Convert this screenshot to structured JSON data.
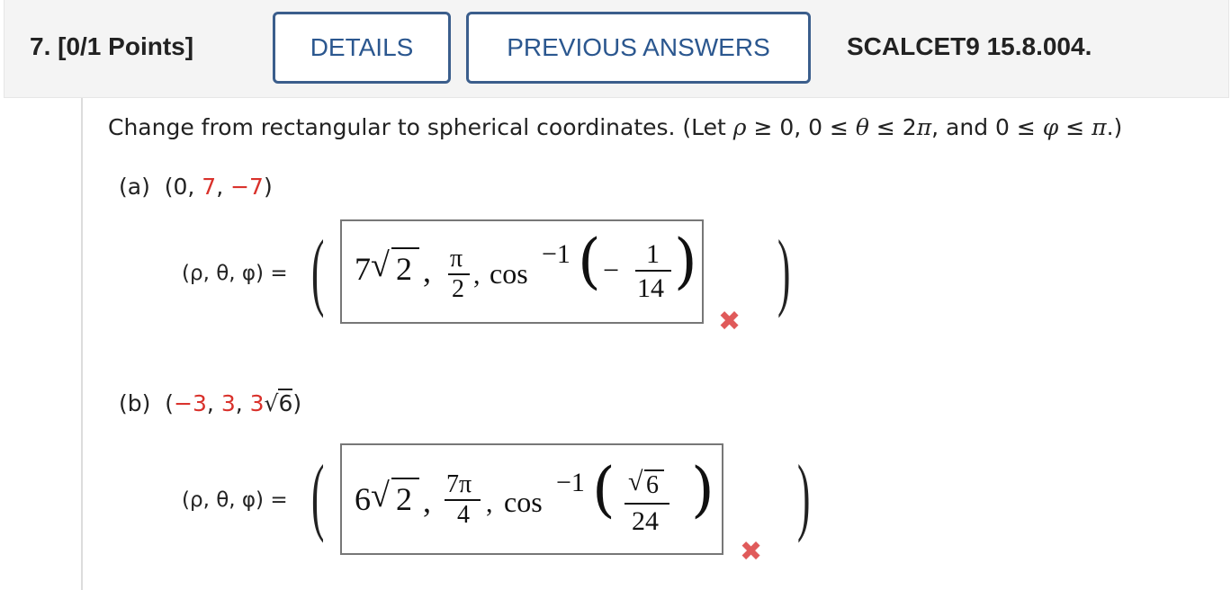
{
  "header": {
    "question": "7.  [0/1 Points]",
    "details_label": "DETAILS",
    "previous_answers_label": "PREVIOUS ANSWERS",
    "course_code": "SCALCET9 15.8.004."
  },
  "prompt": {
    "text": "Change from rectangular to spherical coordinates. (Let ",
    "cond_rho": "ρ",
    "cond_ge0": " ≥ 0, 0 ≤ ",
    "cond_theta": "θ",
    "cond_le2": " ≤ 2",
    "cond_pi": "π",
    "cond_and": ", and 0 ≤ ",
    "cond_phi": "φ",
    "cond_le": " ≤ ",
    "cond_pi2": "π",
    "cond_end": ".)"
  },
  "part_a": {
    "label": "(a)",
    "point_open": "(0, ",
    "y": "7",
    "sep": ", ",
    "z": "−7",
    "point_close": ")",
    "coord_label": "(ρ, θ, φ) =",
    "answer": {
      "rho_coef": "7",
      "rho_rad": "2",
      "comma": ",",
      "theta_num": "π",
      "theta_den": "2",
      "cos": "cos",
      "exp": "−1",
      "arg_sign": "−",
      "arg_num": "1",
      "arg_den": "14"
    },
    "status": "incorrect",
    "status_icon": "x-mark-icon"
  },
  "part_b": {
    "label": "(b)",
    "point_open": "(",
    "x": "−3",
    "sep": ", ",
    "y": "3",
    "z_coef": "3",
    "z_rad": "6",
    "point_close": ")",
    "coord_label": "(ρ, θ, φ) =",
    "answer": {
      "rho_coef": "6",
      "rho_rad": "2",
      "comma": ",",
      "theta_num": "7π",
      "theta_den": "4",
      "cos": "cos",
      "exp": "−1",
      "arg_num_rad": "6",
      "arg_den": "24"
    },
    "status": "incorrect",
    "status_icon": "x-mark-icon"
  },
  "colors": {
    "button_border": "#3b5e8c",
    "button_text": "#2b578f",
    "highlight_red": "#d9312b",
    "x_mark": "#e05a5a"
  }
}
